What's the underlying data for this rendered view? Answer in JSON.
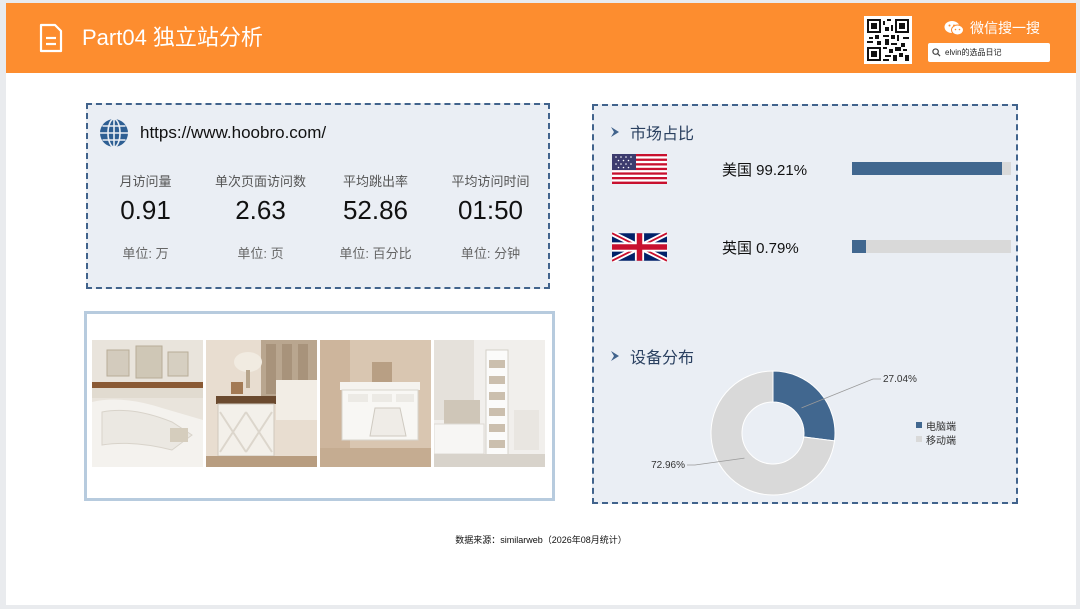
{
  "header": {
    "title": "Part04 独立站分析",
    "wechat_label": "微信搜一搜",
    "search_text": "elvin的选品日记"
  },
  "site": {
    "url": "https://www.hoobro.com/"
  },
  "stats": [
    {
      "label": "月访问量",
      "value": "0.91",
      "unit": "单位:  万"
    },
    {
      "label": "单次页面访问数",
      "value": "2.63",
      "unit": "单位:  页"
    },
    {
      "label": "平均跳出率",
      "value": "52.86",
      "unit": "单位:  百分比"
    },
    {
      "label": "平均访问时间",
      "value": "01:50",
      "unit": "单位:  分钟"
    }
  ],
  "market": {
    "title": "市场占比",
    "rows": [
      {
        "label": "美国 99.21%",
        "share": 0.9921,
        "flag": "us-flag-icon"
      },
      {
        "label": "英国 0.79%",
        "share": 0.0079,
        "flag": "uk-flag-icon"
      }
    ],
    "bar_color": "#41678f",
    "track_color": "#d9d9d9"
  },
  "device": {
    "title": "设备分布",
    "series": [
      {
        "name": "电脑端",
        "value": 27.04,
        "label": "27.04%",
        "color": "#41678f"
      },
      {
        "name": "移动端",
        "value": 72.96,
        "label": "72.96%",
        "color": "#d9d9d9"
      }
    ]
  },
  "footer": {
    "source": "数据来源：similarweb（2026年08月统计）"
  },
  "colors": {
    "header": "#fd8d2f",
    "panel_border": "#41638c",
    "panel_bg": "#eaeef4"
  }
}
